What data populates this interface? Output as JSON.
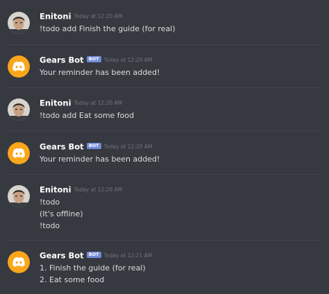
{
  "messages": [
    {
      "author": "Enitoni",
      "avatar": "user-avatar",
      "bot": false,
      "timestamp": "Today at 12:20 AM",
      "lines": [
        "!todo add Finish the guide (for real)"
      ]
    },
    {
      "author": "Gears Bot",
      "avatar": "discord-logo-avatar",
      "bot": true,
      "bot_tag": "BOT",
      "timestamp": "Today at 12:20 AM",
      "lines": [
        "Your reminder has been added!"
      ]
    },
    {
      "author": "Enitoni",
      "avatar": "user-avatar",
      "bot": false,
      "timestamp": "Today at 12:20 AM",
      "lines": [
        "!todo add Eat some food"
      ]
    },
    {
      "author": "Gears Bot",
      "avatar": "discord-logo-avatar",
      "bot": true,
      "bot_tag": "BOT",
      "timestamp": "Today at 12:20 AM",
      "lines": [
        "Your reminder has been added!"
      ]
    },
    {
      "author": "Enitoni",
      "avatar": "user-avatar",
      "bot": false,
      "timestamp": "Today at 12:20 AM",
      "lines": [
        "!todo",
        "(It's offline)",
        "!todo"
      ]
    },
    {
      "author": "Gears Bot",
      "avatar": "discord-logo-avatar",
      "bot": true,
      "bot_tag": "BOT",
      "timestamp": "Today at 12:21 AM",
      "lines": [
        "1. Finish the guide (for real)",
        "2. Eat some food"
      ]
    }
  ],
  "colors": {
    "background": "#36393f",
    "username": "#ffffff",
    "message_text": "#dcddde",
    "timestamp": "#72767d",
    "bot_tag": "#7289da",
    "bot_avatar": "#faa61a",
    "divider": "#42454a"
  }
}
